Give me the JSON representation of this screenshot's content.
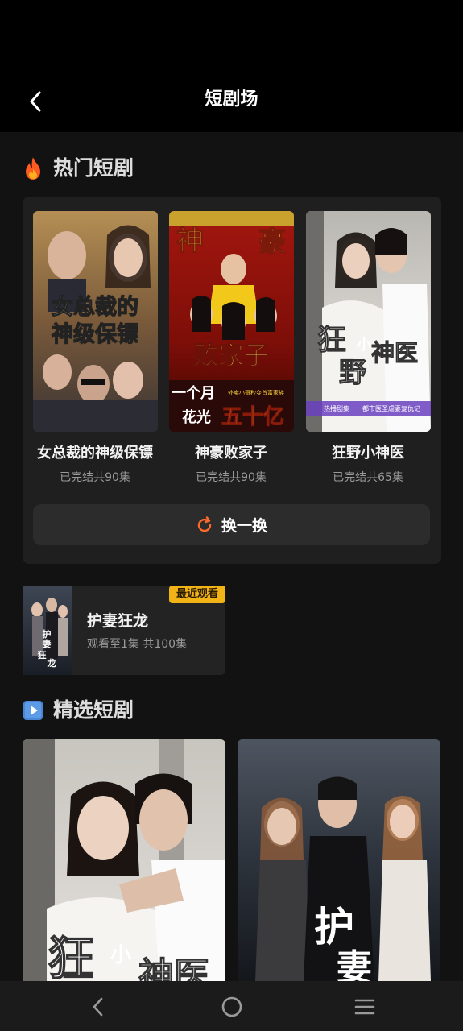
{
  "header": {
    "title": "短剧场",
    "back_icon": "chevron-left-icon"
  },
  "hot_section": {
    "title": "热门短剧",
    "icon": "fire-icon",
    "items": [
      {
        "title": "女总裁的神级保镖",
        "meta": "已完结共90集",
        "poster_text": [
          "女总裁的",
          "神级保镖"
        ]
      },
      {
        "title": "神豪败家子",
        "meta": "已完结共90集",
        "poster_text": [
          "神",
          "豪",
          "败家子",
          "一个月",
          "花光",
          "五十亿",
          "外卖小哥秒变首富家族"
        ]
      },
      {
        "title": "狂野小神医",
        "meta": "已完结共65集",
        "poster_text": [
          "狂",
          "小",
          "神医",
          "野",
          "热播剧集",
          "都市医圣虐妻复仇记"
        ]
      }
    ],
    "swap_label": "换一换",
    "swap_icon": "refresh-icon",
    "accent": "#ff6a2b"
  },
  "recent": {
    "badge": "最近观看",
    "title": "护妻狂龙",
    "progress": "观看至1集 共100集",
    "poster_text": [
      "护",
      "妻",
      "狂",
      "龙"
    ]
  },
  "featured_section": {
    "title": "精选短剧",
    "icon": "play-square-icon",
    "items": [
      {
        "poster_text": [
          "狂",
          "小",
          "神医"
        ]
      },
      {
        "poster_text": [
          "护",
          "妻"
        ]
      }
    ]
  },
  "navbar": {
    "back_icon": "nav-back-icon",
    "home_icon": "nav-home-icon",
    "menu_icon": "nav-menu-icon"
  }
}
